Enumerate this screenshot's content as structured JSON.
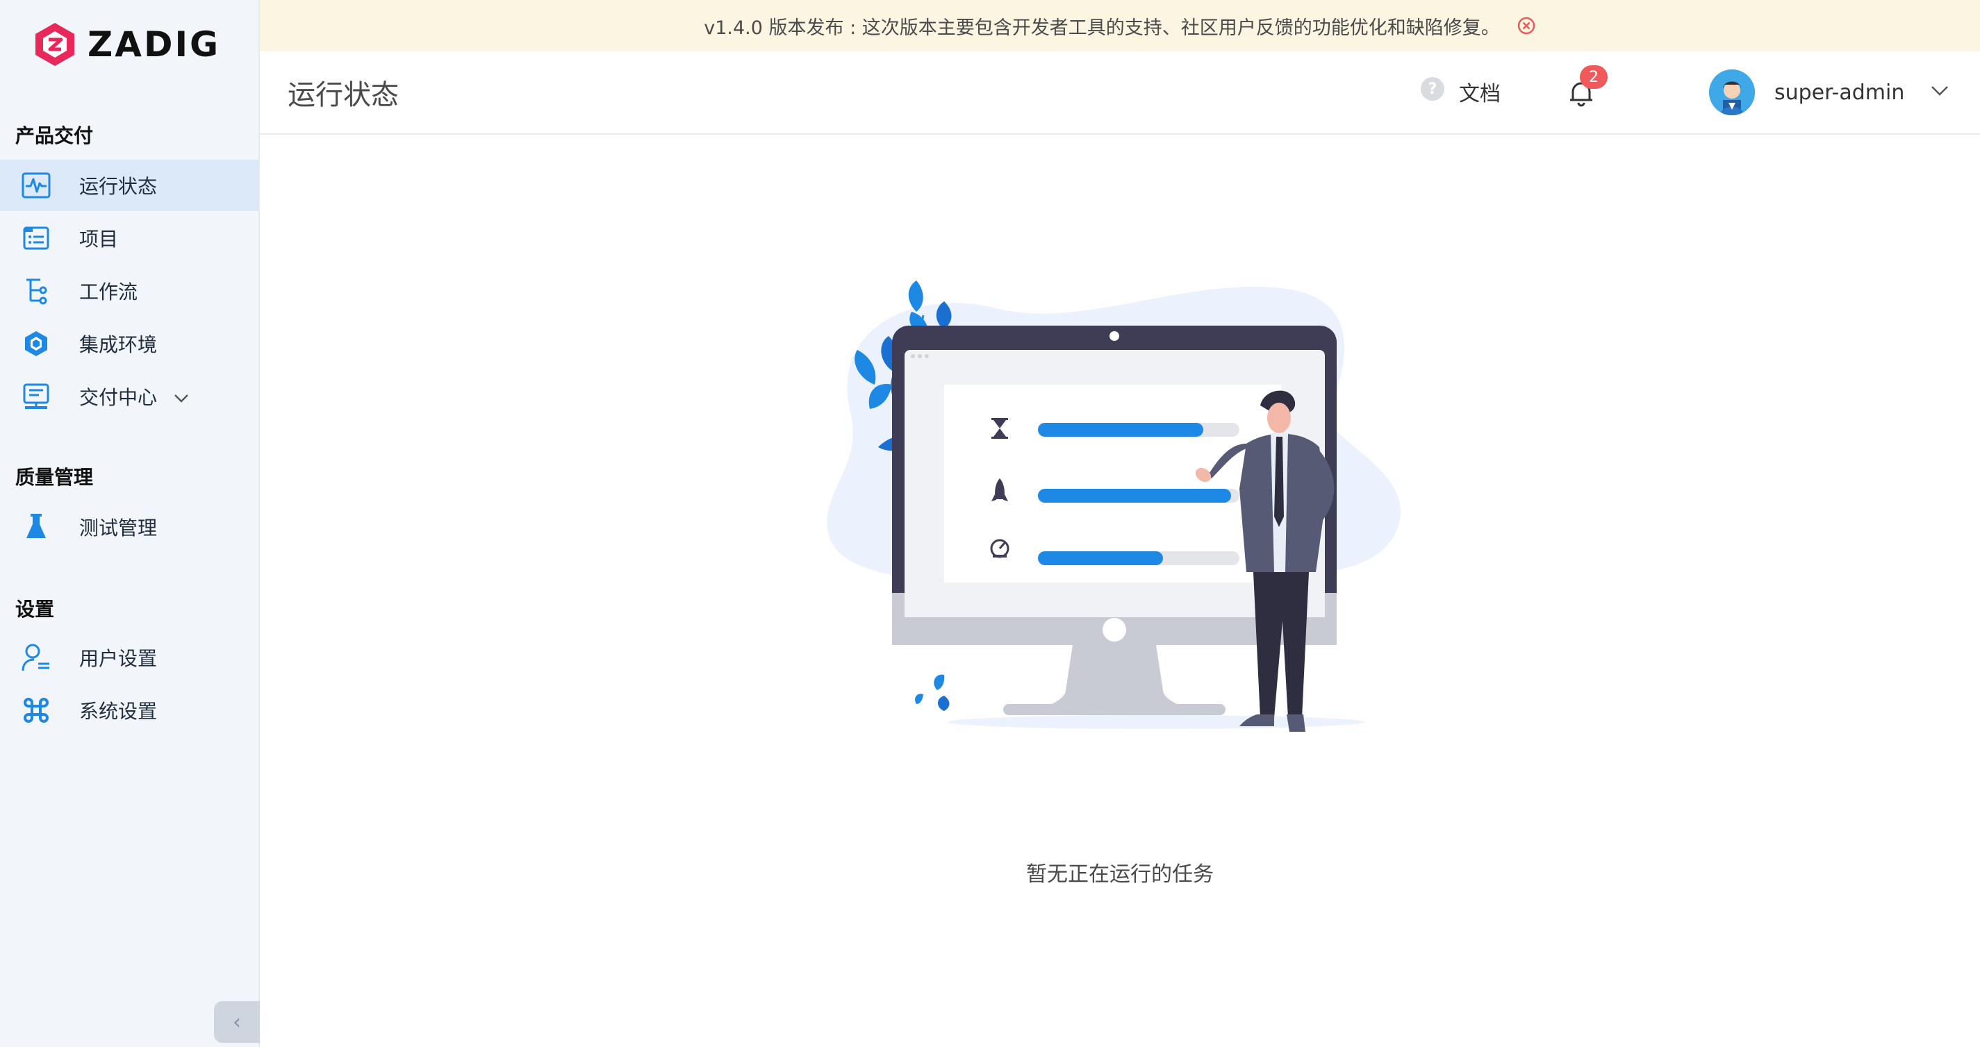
{
  "brand": {
    "name": "ZADIG",
    "accent_color": "#e8285a"
  },
  "banner": {
    "text": "v1.4.0 版本发布 : 这次版本主要包含开发者工具的支持、社区用户反馈的功能优化和缺陷修复。",
    "close_icon": "close-circle-icon"
  },
  "sidebar": {
    "sections": [
      {
        "title": "产品交付"
      },
      {
        "title": "质量管理"
      },
      {
        "title": "设置"
      }
    ],
    "items": [
      {
        "label": "运行状态",
        "icon": "pulse-icon",
        "active": true
      },
      {
        "label": "项目",
        "icon": "list-icon"
      },
      {
        "label": "工作流",
        "icon": "workflow-tree-icon"
      },
      {
        "label": "集成环境",
        "icon": "cube-icon"
      },
      {
        "label": "交付中心",
        "icon": "delivery-icon",
        "has_submenu": true
      },
      {
        "label": "测试管理",
        "icon": "flask-icon"
      },
      {
        "label": "用户设置",
        "icon": "user-settings-icon"
      },
      {
        "label": "系统设置",
        "icon": "command-icon"
      }
    ],
    "collapse_glyph": "‹"
  },
  "header": {
    "title": "运行状态",
    "docs_label": "文档",
    "notification_count": "2",
    "username": "super-admin"
  },
  "main": {
    "empty_text": "暂无正在运行的任务",
    "progress_bars": [
      0.82,
      0.96,
      0.62
    ]
  },
  "colors": {
    "primary": "#1e88e5",
    "sidebar_bg": "#f2f5fa",
    "active_bg": "#dce9f9",
    "banner_bg": "#fbf5e2",
    "badge": "#f05a5a"
  }
}
